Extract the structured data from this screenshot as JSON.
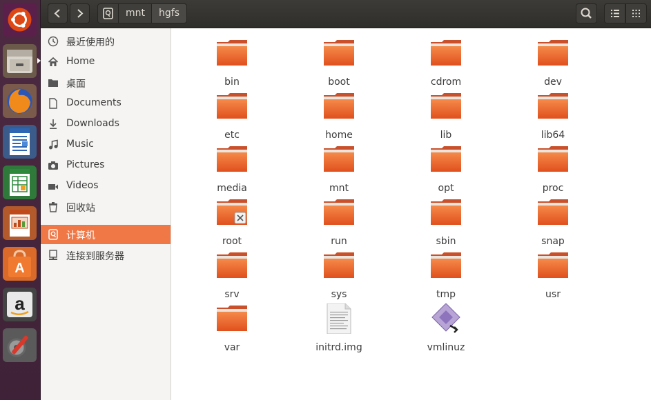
{
  "colors": {
    "accent": "#f07746",
    "launcher_bg": "#4d2a42",
    "folder_orange": "#e65a24"
  },
  "launcher": {
    "items": [
      {
        "name": "ubuntu-dash-icon"
      },
      {
        "name": "files-app-icon"
      },
      {
        "name": "firefox-icon"
      },
      {
        "name": "libreoffice-writer-icon"
      },
      {
        "name": "libreoffice-calc-icon"
      },
      {
        "name": "libreoffice-impress-icon"
      },
      {
        "name": "software-center-icon"
      },
      {
        "name": "amazon-icon"
      },
      {
        "name": "system-settings-icon"
      }
    ]
  },
  "header": {
    "back_icon": "chevron-left-icon",
    "forward_icon": "chevron-right-icon",
    "breadcrumbs": [
      "mnt",
      "hgfs"
    ],
    "search_icon": "search-icon",
    "list_view_icon": "list-view-icon",
    "grid_view_icon": "grid-view-icon"
  },
  "sidebar": {
    "items": [
      {
        "label": "最近使用的",
        "icon": "clock-icon"
      },
      {
        "label": "Home",
        "icon": "home-icon"
      },
      {
        "label": "桌面",
        "icon": "folder-icon"
      },
      {
        "label": "Documents",
        "icon": "document-icon"
      },
      {
        "label": "Downloads",
        "icon": "download-icon"
      },
      {
        "label": "Music",
        "icon": "music-icon"
      },
      {
        "label": "Pictures",
        "icon": "camera-icon"
      },
      {
        "label": "Videos",
        "icon": "video-icon"
      },
      {
        "label": "回收站",
        "icon": "trash-icon"
      },
      {
        "label": "计算机",
        "icon": "computer-icon"
      },
      {
        "label": "连接到服务器",
        "icon": "server-icon"
      }
    ],
    "selected": "计算机"
  },
  "files": [
    {
      "name": "bin",
      "type": "folder"
    },
    {
      "name": "boot",
      "type": "folder"
    },
    {
      "name": "cdrom",
      "type": "folder"
    },
    {
      "name": "dev",
      "type": "folder"
    },
    {
      "name": "etc",
      "type": "folder"
    },
    {
      "name": "home",
      "type": "folder"
    },
    {
      "name": "lib",
      "type": "folder"
    },
    {
      "name": "lib64",
      "type": "folder"
    },
    {
      "name": "media",
      "type": "folder"
    },
    {
      "name": "mnt",
      "type": "folder"
    },
    {
      "name": "opt",
      "type": "folder"
    },
    {
      "name": "proc",
      "type": "folder"
    },
    {
      "name": "root",
      "type": "folder-locked"
    },
    {
      "name": "run",
      "type": "folder"
    },
    {
      "name": "sbin",
      "type": "folder"
    },
    {
      "name": "snap",
      "type": "folder"
    },
    {
      "name": "srv",
      "type": "folder"
    },
    {
      "name": "sys",
      "type": "folder"
    },
    {
      "name": "tmp",
      "type": "folder"
    },
    {
      "name": "usr",
      "type": "folder"
    },
    {
      "name": "var",
      "type": "folder"
    },
    {
      "name": "initrd.img",
      "type": "text-file"
    },
    {
      "name": "vmlinuz",
      "type": "binary-file"
    }
  ]
}
